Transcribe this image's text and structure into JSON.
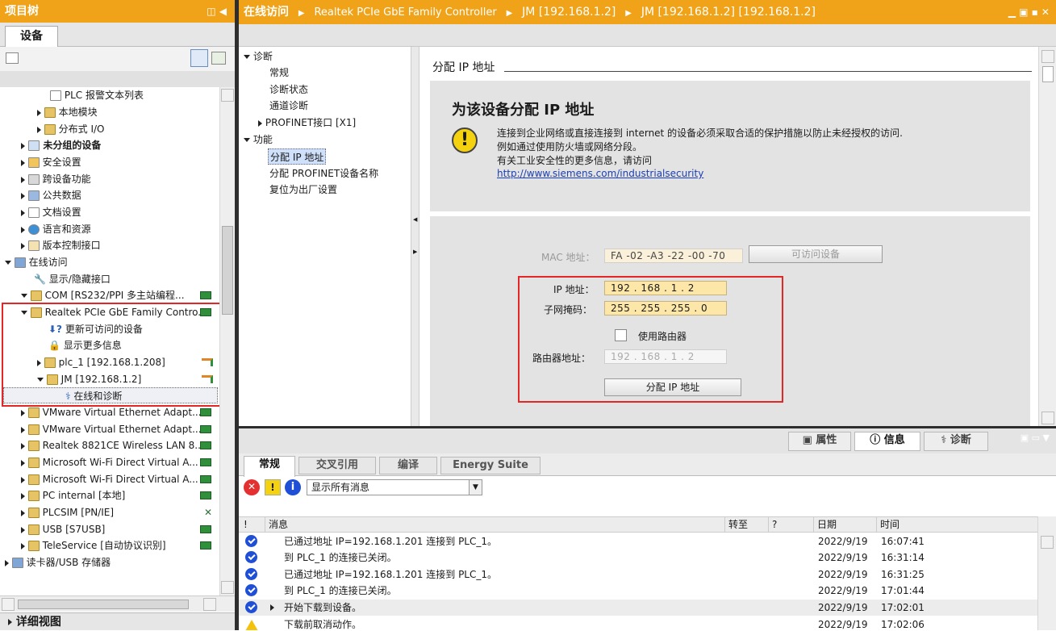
{
  "left_panel": {
    "title": "项目树",
    "tab": "设备",
    "items": [
      {
        "label": "PLC 报警文本列表",
        "bold": false
      },
      {
        "label": "本地模块",
        "bold": false
      },
      {
        "label": "分布式 I/O",
        "bold": false
      },
      {
        "label": "未分组的设备",
        "bold": true
      },
      {
        "label": "安全设置",
        "bold": false
      },
      {
        "label": "跨设备功能",
        "bold": false
      },
      {
        "label": "公共数据",
        "bold": false
      },
      {
        "label": "文档设置",
        "bold": false
      },
      {
        "label": "语言和资源",
        "bold": false
      },
      {
        "label": "版本控制接口",
        "bold": false
      },
      {
        "label": "在线访问",
        "bold": false
      },
      {
        "label": "显示/隐藏接口",
        "bold": false
      },
      {
        "label": "COM [RS232/PPI 多主站编程...",
        "bold": false
      },
      {
        "label": "Realtek PCIe GbE Family Contro...",
        "bold": false
      },
      {
        "label": "更新可访问的设备",
        "bold": false
      },
      {
        "label": "显示更多信息",
        "bold": false
      },
      {
        "label": "plc_1 [192.168.1.208]",
        "bold": false
      },
      {
        "label": "JM [192.168.1.2]",
        "bold": false
      },
      {
        "label": "在线和诊断",
        "bold": false
      },
      {
        "label": "VMware Virtual Ethernet Adapt...",
        "bold": false
      },
      {
        "label": "VMware Virtual Ethernet Adapt...",
        "bold": false
      },
      {
        "label": "Realtek 8821CE Wireless LAN 8...",
        "bold": false
      },
      {
        "label": "Microsoft Wi-Fi Direct Virtual A...",
        "bold": false
      },
      {
        "label": "Microsoft Wi-Fi Direct Virtual A...",
        "bold": false
      },
      {
        "label": "PC internal [本地]",
        "bold": false
      },
      {
        "label": "PLCSIM [PN/IE]",
        "bold": false
      },
      {
        "label": "USB [S7USB]",
        "bold": false
      },
      {
        "label": "TeleService [自动协议识别]",
        "bold": false
      },
      {
        "label": "读卡器/USB 存储器",
        "bold": false
      }
    ],
    "detail_view": "详细视图"
  },
  "header": {
    "crumbs": [
      "在线访问",
      "Realtek PCIe GbE Family Controller",
      "JM [192.168.1.2]",
      "JM [192.168.1.2] [192.168.1.2]"
    ]
  },
  "nav": {
    "diag": "诊断",
    "general": "常规",
    "diag_status": "诊断状态",
    "channel_diag": "通道诊断",
    "profinet": "PROFINET接口 [X1]",
    "func": "功能",
    "assign_ip": "分配 IP 地址",
    "assign_name": "分配 PROFINET设备名称",
    "reset": "复位为出厂设置"
  },
  "content": {
    "section": "分配 IP 地址",
    "heading": "为该设备分配 IP 地址",
    "warn1": "连接到企业网络或直接连接到 internet 的设备必须采取合适的保护措施以防止未经授权的访问.",
    "warn2": "例如通过使用防火墙或网络分段。",
    "warn3": "有关工业安全性的更多信息，请访问",
    "link": "http://www.siemens.com/industrialsecurity",
    "mac_label": "MAC 地址：",
    "mac": "FA -02 -A3 -22 -00 -70",
    "accessible_btn": "可访问设备",
    "ip_label": "IP 地址：",
    "ip": "192 . 168 . 1 . 2",
    "mask_label": "子网掩码：",
    "mask": "255 . 255 . 255 . 0",
    "router_chk": "使用路由器",
    "router_label": "路由器地址：",
    "router": "192 . 168 . 1 . 2",
    "assign_btn": "分配 IP 地址"
  },
  "inspector": {
    "props": "属性",
    "info": "信息",
    "diag": "诊断"
  },
  "bottom": {
    "tabs": [
      "常规",
      "交叉引用",
      "编译",
      "Energy Suite"
    ],
    "filter": "显示所有消息",
    "cols": {
      "bang": "!",
      "msg": "消息",
      "goto": "转至",
      "q": "?",
      "date": "日期",
      "time": "时间"
    },
    "rows": [
      {
        "icon": "info",
        "msg": "已通过地址 IP=192.168.1.201 连接到 PLC_1。",
        "date": "2022/9/19",
        "time": "16:07:41"
      },
      {
        "icon": "info",
        "msg": "到 PLC_1 的连接已关闭。",
        "date": "2022/9/19",
        "time": "16:31:14"
      },
      {
        "icon": "info",
        "msg": "已通过地址 IP=192.168.1.201 连接到 PLC_1。",
        "date": "2022/9/19",
        "time": "16:31:25"
      },
      {
        "icon": "info",
        "msg": "到 PLC_1 的连接已关闭。",
        "date": "2022/9/19",
        "time": "17:01:44"
      },
      {
        "icon": "info",
        "msg": "开始下载到设备。",
        "date": "2022/9/19",
        "time": "17:02:01"
      },
      {
        "icon": "warn",
        "msg": "下载前取消动作。",
        "date": "2022/9/19",
        "time": "17:02:06"
      }
    ]
  },
  "colors": {
    "accent": "#f0a318",
    "highlight": "#e32626",
    "link": "#1b3fb3"
  }
}
